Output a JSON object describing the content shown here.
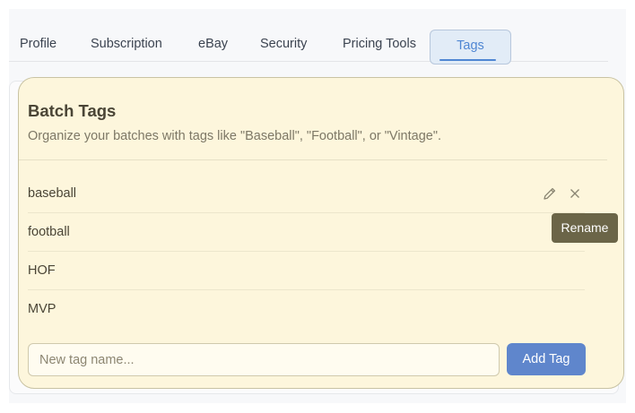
{
  "tabs": [
    {
      "label": "Profile",
      "active": false
    },
    {
      "label": "Subscription",
      "active": false
    },
    {
      "label": "eBay",
      "active": false
    },
    {
      "label": "Security",
      "active": false
    },
    {
      "label": "Pricing Tools",
      "active": false
    },
    {
      "label": "Tags",
      "active": true
    }
  ],
  "card": {
    "title": "Batch Tags",
    "description": "Organize your batches with tags like \"Baseball\", \"Football\", or \"Vintage\"."
  },
  "tags": [
    {
      "label": "baseball"
    },
    {
      "label": "football"
    },
    {
      "label": "HOF"
    },
    {
      "label": "MVP"
    }
  ],
  "row_actions": {
    "rename_icon": "pencil-icon",
    "delete_icon": "close-icon"
  },
  "tooltip": {
    "text": "Rename"
  },
  "new_tag": {
    "placeholder": "New tag name...",
    "value": ""
  },
  "add_button": {
    "label": "Add Tag"
  },
  "colors": {
    "accent": "#4f86d3",
    "button": "#5f86cc",
    "highlight": "#fdf6dc",
    "tooltip": "#6b6548"
  }
}
